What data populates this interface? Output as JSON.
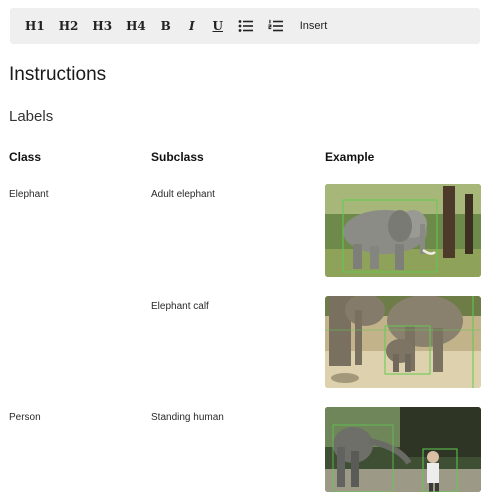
{
  "toolbar": {
    "buttons": [
      {
        "label": "H1",
        "name": "h1-button"
      },
      {
        "label": "H2",
        "name": "h2-button"
      },
      {
        "label": "H3",
        "name": "h3-button"
      },
      {
        "label": "H4",
        "name": "h4-button"
      },
      {
        "label": "B",
        "name": "bold-button"
      },
      {
        "label": "I",
        "name": "italic-button"
      },
      {
        "label": "U",
        "name": "underline-button"
      }
    ],
    "bullet_list_icon": "bullet-list-icon",
    "numbered_list_icon": "numbered-list-icon",
    "insert_label": "Insert"
  },
  "title": "Instructions",
  "section_title": "Labels",
  "table": {
    "headers": {
      "class": "Class",
      "subclass": "Subclass",
      "example": "Example"
    },
    "rows": [
      {
        "class": "Elephant",
        "subclass": "Adult elephant",
        "image": "adult-elephant-example-image"
      },
      {
        "class": "",
        "subclass": "Elephant calf",
        "image": "elephant-calf-example-image"
      },
      {
        "class": "Person",
        "subclass": "Standing human",
        "image": "standing-human-example-image"
      }
    ]
  },
  "colors": {
    "toolbar_bg": "#efefef",
    "bounding_box": "#5ecb4f"
  }
}
